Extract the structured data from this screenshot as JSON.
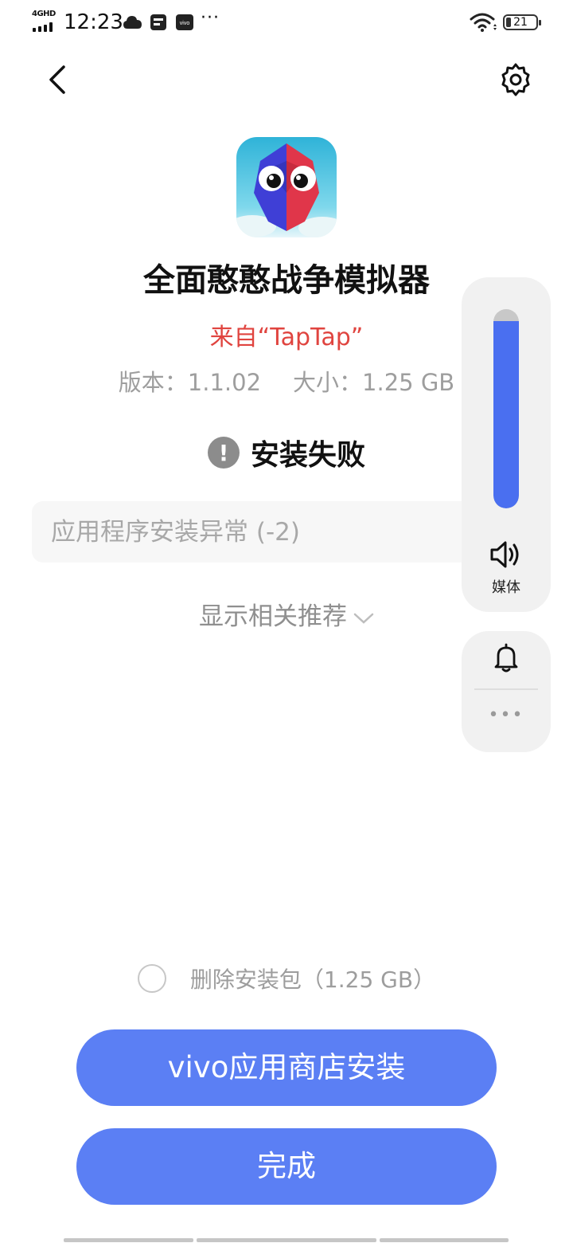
{
  "status_bar": {
    "network": "4GHD",
    "time": "12:23",
    "battery": "21",
    "more": "···"
  },
  "app": {
    "name": "全面憨憨战争模拟器",
    "source": "来自“TapTap”",
    "version_label": "版本：1.1.02",
    "size_label": "大小：1.25 GB"
  },
  "install": {
    "status": "安装失败",
    "status_icon": "!",
    "error": "应用程序安装异常 (-2)",
    "recommend": "显示相关推荐"
  },
  "volume": {
    "label": "媒体",
    "level": 0.94,
    "more": "•••",
    "accent": "#4a6ff0"
  },
  "footer": {
    "delete_label": "删除安装包（1.25 GB）",
    "store_button": "vivo应用商店安装",
    "done_button": "完成",
    "button_color": "#5b7ff4"
  }
}
